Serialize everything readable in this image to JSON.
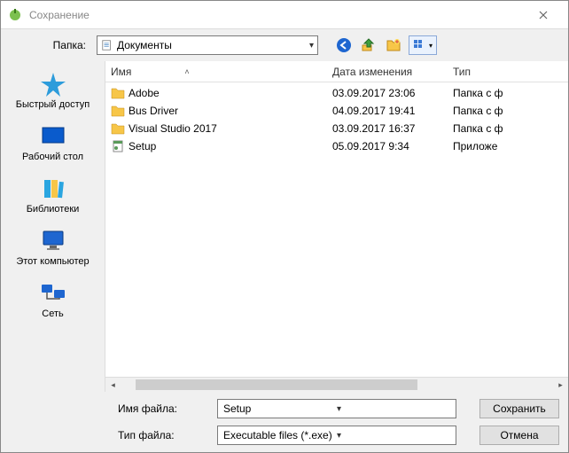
{
  "title": "Сохранение",
  "folder_label": "Папка:",
  "current_folder": "Документы",
  "sidebar": {
    "items": [
      {
        "label": "Быстрый доступ"
      },
      {
        "label": "Рабочий стол"
      },
      {
        "label": "Библиотеки"
      },
      {
        "label": "Этот компьютер"
      },
      {
        "label": "Сеть"
      }
    ]
  },
  "columns": {
    "name": "Имя",
    "date": "Дата изменения",
    "type": "Тип"
  },
  "files": [
    {
      "name": "Adobe",
      "date": "03.09.2017 23:06",
      "type": "Папка с ф",
      "kind": "folder"
    },
    {
      "name": "Bus Driver",
      "date": "04.09.2017 19:41",
      "type": "Папка с ф",
      "kind": "folder"
    },
    {
      "name": "Visual Studio 2017",
      "date": "03.09.2017 16:37",
      "type": "Папка с ф",
      "kind": "folder"
    },
    {
      "name": "Setup",
      "date": "05.09.2017 9:34",
      "type": "Приложе",
      "kind": "exe"
    }
  ],
  "filename_label": "Имя файла:",
  "filetype_label": "Тип файла:",
  "filename_value": "Setup",
  "filetype_value": "Executable files (*.exe)",
  "save_btn": "Сохранить",
  "cancel_btn": "Отмена"
}
